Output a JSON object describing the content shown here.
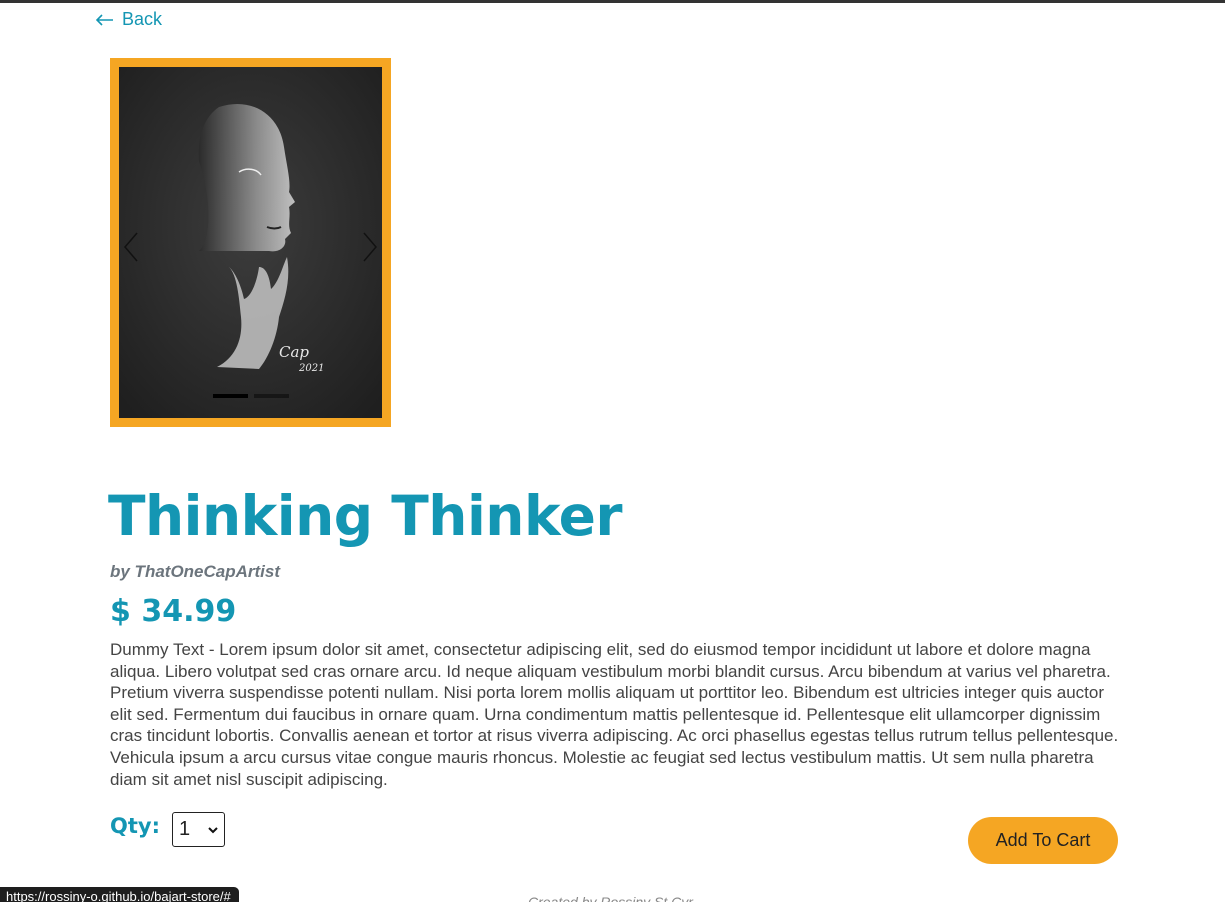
{
  "nav": {
    "back_label": "Back",
    "back_icon": "arrow-left-icon"
  },
  "carousel": {
    "frame_color": "#f5a623",
    "slide_count": 2,
    "active_index": 0,
    "prev_icon": "chevron-left-icon",
    "next_icon": "chevron-right-icon",
    "signature": "Cap 2021"
  },
  "product": {
    "title": "Thinking Thinker",
    "artist": "by ThatOneCapArtist",
    "price": "$ 34.99",
    "description": "Dummy Text - Lorem ipsum dolor sit amet, consectetur adipiscing elit, sed do eiusmod tempor incididunt ut labore et dolore magna aliqua. Libero volutpat sed cras ornare arcu. Id neque aliquam vestibulum morbi blandit cursus. Arcu bibendum at varius vel pharetra. Pretium viverra suspendisse potenti nullam. Nisi porta lorem mollis aliquam ut porttitor leo. Bibendum est ultricies integer quis auctor elit sed. Fermentum dui faucibus in ornare quam. Urna condimentum mattis pellentesque id. Pellentesque elit ullamcorper dignissim cras tincidunt lobortis. Convallis aenean et tortor at risus viverra adipiscing. Ac orci phasellus egestas tellus rutrum tellus pellentesque. Vehicula ipsum a arcu cursus vitae congue mauris rhoncus. Molestie ac feugiat sed lectus vestibulum mattis. Ut sem nulla pharetra diam sit amet nisl suscipit adipiscing."
  },
  "purchase": {
    "qty_label": "Qty:",
    "qty_value": "1",
    "add_to_cart_label": "Add To Cart"
  },
  "footer": {
    "credit": "Created by Rossiny St Cyr"
  },
  "status_bar": {
    "url": "https://rossiny-o.github.io/bajart-store/#"
  },
  "colors": {
    "accent": "#1496b3",
    "button": "#f5a623"
  }
}
